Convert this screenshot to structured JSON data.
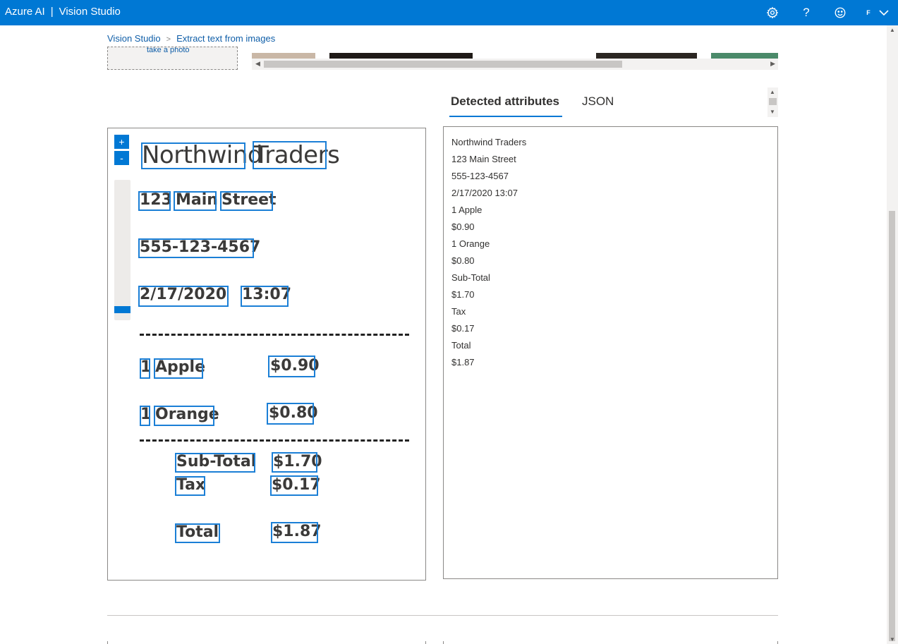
{
  "header": {
    "brand_left": "Azure AI",
    "brand_sep": "|",
    "brand_right": "Vision Studio",
    "user_initial": "F",
    "icons": [
      "gear-icon",
      "help-icon",
      "feedback-smiley-icon",
      "chevron-down-icon"
    ]
  },
  "breadcrumb": {
    "root": "Vision Studio",
    "current": "Extract text from images"
  },
  "upload": {
    "label_cut": "take a photo"
  },
  "tabs": {
    "detected": "Detected attributes",
    "json": "JSON"
  },
  "receipt": {
    "line_title": "Northwind Traders",
    "words": {
      "northwind": "Northwind",
      "traders": "Traders",
      "n123": "123",
      "main": "Main",
      "street": "Street",
      "phone": "555-123-4567",
      "date": "2/17/2020",
      "time": "13:07",
      "qty1": "1",
      "apple": "Apple",
      "price1": "$0.90",
      "qty2": "1",
      "orange": "Orange",
      "price2": "$0.80",
      "subtotal": "Sub-Total",
      "subtotal_val": "$1.70",
      "tax": "Tax",
      "tax_val": "$0.17",
      "total": "Total",
      "total_val": "$1.87"
    }
  },
  "zoom": {
    "plus": "+",
    "minus": "-"
  },
  "detected_lines": [
    "Northwind Traders",
    "123 Main Street",
    "555-123-4567",
    "2/17/2020 13:07",
    "1 Apple",
    "$0.90",
    "1 Orange",
    "$0.80",
    "Sub-Total",
    "$1.70",
    "Tax",
    "$0.17",
    "Total",
    "$1.87"
  ],
  "colors": {
    "accent": "#0078d4",
    "bbox": "#1b7fd6",
    "link": "#0f5ea8"
  }
}
